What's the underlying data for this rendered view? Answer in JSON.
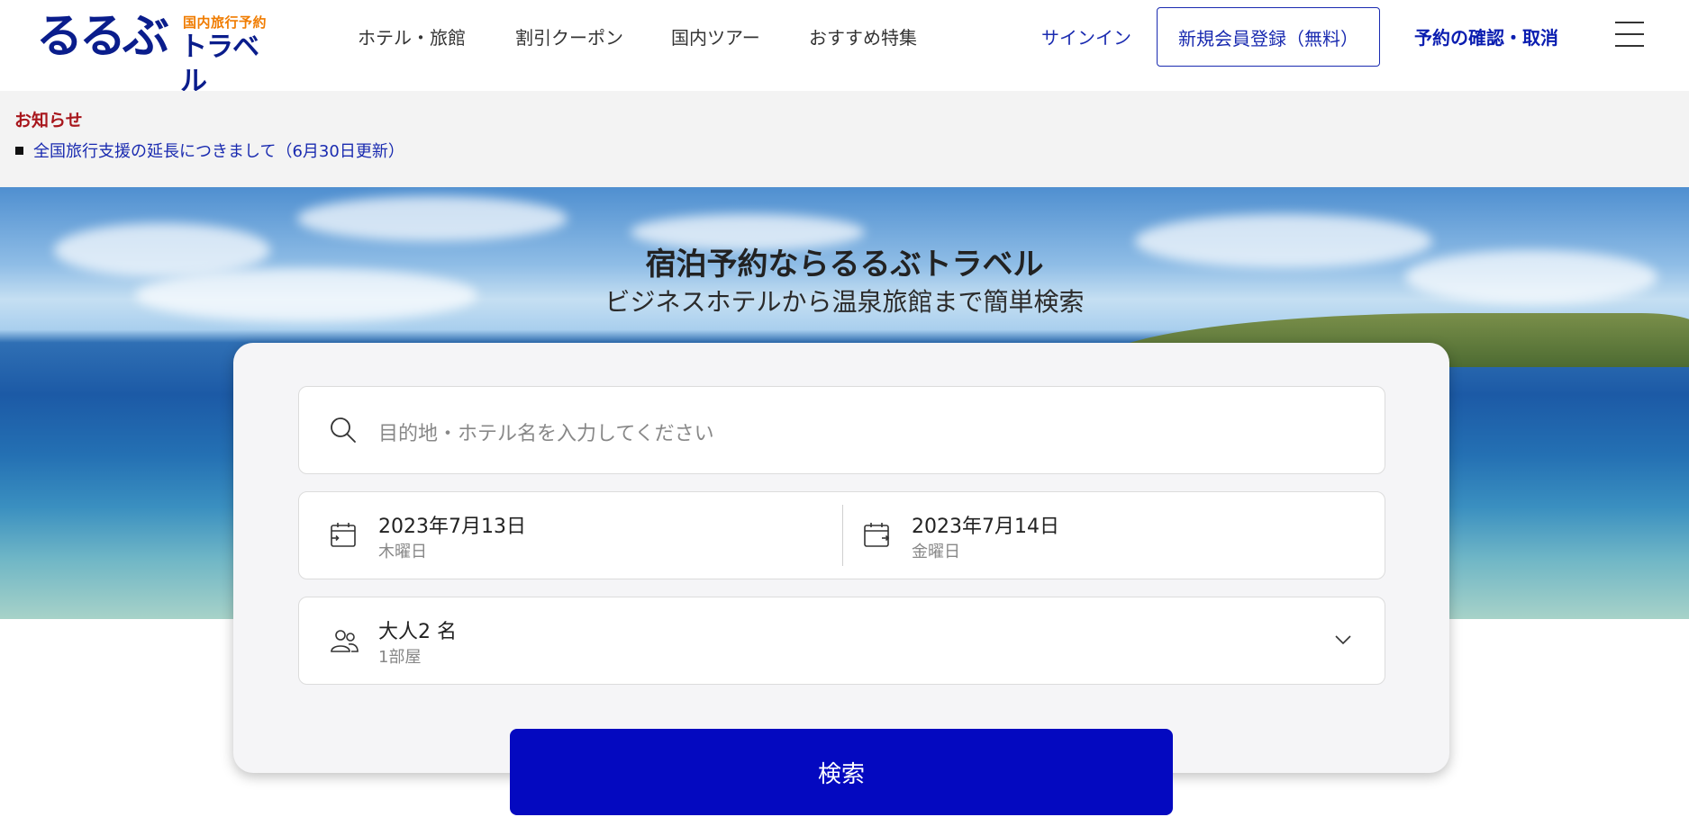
{
  "brand": {
    "logo_main": "るるぶ",
    "logo_sub": "国内旅行予約",
    "logo_travel": "トラベル",
    "primary_color": "#0a1d8c",
    "accent_color": "#f07c00"
  },
  "nav": {
    "items": [
      "ホテル・旅館",
      "割引クーポン",
      "国内ツアー",
      "おすすめ特集"
    ],
    "signin": "サインイン",
    "register": "新規会員登録（無料）",
    "reserve_check": "予約の確認・取消",
    "menu_icon": "hamburger-menu-icon"
  },
  "notice": {
    "title": "お知らせ",
    "items": [
      "全国旅行支援の延長につきまして（6月30日更新）"
    ]
  },
  "hero": {
    "title": "宿泊予約ならるるぶトラベル",
    "subtitle": "ビジネスホテルから温泉旅館まで簡単検索"
  },
  "search": {
    "placeholder": "目的地・ホテル名を入力してください",
    "checkin": {
      "date": "2023年7月13日",
      "weekday": "木曜日"
    },
    "checkout": {
      "date": "2023年7月14日",
      "weekday": "金曜日"
    },
    "guests": {
      "adults": "大人2 名",
      "rooms": "1部屋"
    },
    "button": "検索",
    "button_color": "#0409c0"
  }
}
